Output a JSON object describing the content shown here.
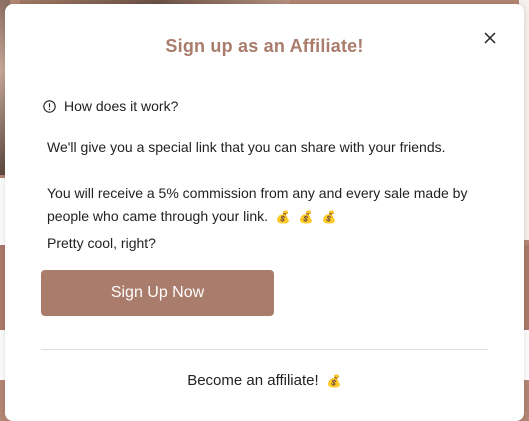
{
  "modal": {
    "title": "Sign up as an Affiliate!",
    "close_icon": "close-icon",
    "how_label": "How does it work?",
    "paragraph1": "We'll give you a special link that you can share with your friends.",
    "paragraph2": "You will receive a 5% commission from any and every sale made by people who came through your link.",
    "money_bag": "💰",
    "paragraph3": "Pretty cool, right?",
    "cta_label": "Sign Up Now",
    "footer_text": "Become an affiliate!"
  },
  "colors": {
    "accent": "#a97c6c",
    "text": "#222222",
    "divider": "#dedede"
  }
}
